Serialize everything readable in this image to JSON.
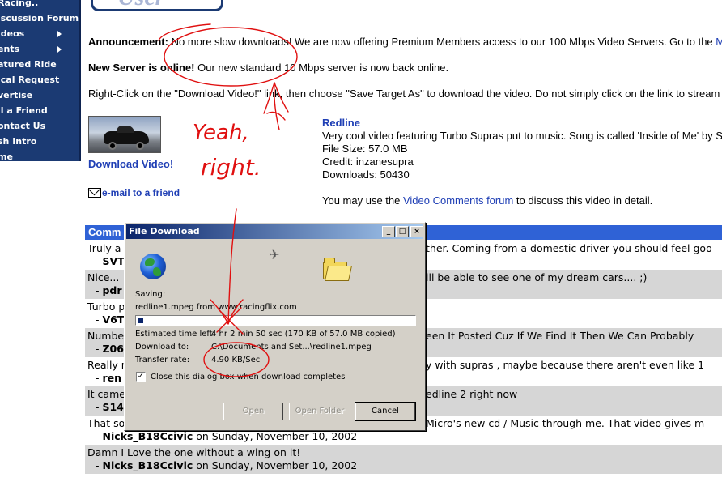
{
  "nav": {
    "items": [
      {
        "label": "Racing.."
      },
      {
        "label": "iscussion Forums"
      },
      {
        "label": "ideos",
        "arrow": true
      },
      {
        "label": "ents",
        "arrow": true
      },
      {
        "label": "atured Ride"
      },
      {
        "label": "ical Request"
      },
      {
        "label": "vertise"
      },
      {
        "label": "ll a Friend"
      },
      {
        "label": "ontact Us"
      },
      {
        "label": "sh Intro"
      },
      {
        "label": "me"
      }
    ]
  },
  "header": {
    "logo_text": "User Video"
  },
  "announcement": {
    "label": "Announcement:",
    "text": "No more slow downloads! We are now offering Premium Members access to our 100 Mbps Video Servers. Go to the",
    "link_frag": "M"
  },
  "server": {
    "label": "New Server is online!",
    "text": "Our new standard 10 Mbps server is now back online."
  },
  "instruction": "Right-Click on the \"Download Video!\" link, then choose \"Save Target As\" to download the video. Do not simply click on the link to stream",
  "video": {
    "download_label": "Download Video!",
    "email_label": "e-mail to a friend",
    "title": "Redline",
    "description": "Very cool video featuring Turbo Supras put to music. Song is called 'Inside of Me' by S",
    "file_size": "File Size: 57.0 MB",
    "credit": "Credit: inzanesupra",
    "downloads": "Downloads: 50430",
    "discuss_pre": "You may use the ",
    "discuss_link": "Video Comments forum",
    "discuss_post": " to discuss this video in detail."
  },
  "comments": {
    "header": "Comm",
    "rows": [
      {
        "text_left": "Truly a",
        "text_right": "ther. Coming from a domestic driver you should feel goo",
        "by_user": "SVT",
        "by_rest": ""
      },
      {
        "text_left": "Nice...",
        "text_right": "ill be able to see one of my dream cars.... ;)",
        "by_user": "pdr",
        "by_rest": ""
      },
      {
        "text_left": "Turbo p",
        "text_right": "",
        "by_user": "V6T",
        "by_rest": ""
      },
      {
        "text_left": "Numbe",
        "text_right": "een It Posted Cuz If We Find It Then We Can Probably",
        "by_user": "Z06",
        "by_rest": ""
      },
      {
        "text_left": "Really r",
        "text_right": "y with supras , maybe because there aren't even like 1",
        "by_user": "ren",
        "by_rest": ""
      },
      {
        "text_left": "It came",
        "text_right": "edline 2 right now",
        "by_user": "S14",
        "by_rest": ""
      },
      {
        "text_left": "That so",
        "text_right": "Micro's new cd / Music through me. That video gives m",
        "by_user": "Nicks_B18Ccivic",
        "by_rest": " on Sunday, November 10, 2002"
      },
      {
        "text_left": "Damn I Love the one without a wing on it!",
        "text_right": "",
        "by_user": "Nicks_B18Ccivic",
        "by_rest": " on Sunday, November 10, 2002"
      }
    ]
  },
  "dialog": {
    "title": "File Download",
    "saving_label": "Saving:",
    "file_line": "redline1.mpeg from www.racingflix.com",
    "progress": 0.02,
    "time_left_label": "Estimated time left:",
    "time_left_value": "4 hr 2 min 50 sec (170 KB of 57.0 MB copied)",
    "download_to_label": "Download to:",
    "download_to_value": "C:\\Documents and Set...\\redline1.mpeg",
    "rate_label": "Transfer rate:",
    "rate_value": "4.90 KB/Sec",
    "close_checkbox_label": "Close this dialog box when download completes",
    "close_checked": true,
    "open_button": "Open",
    "open_folder_button": "Open Folder",
    "cancel_button": "Cancel"
  },
  "annotation": {
    "handwriting_1": "Yeah,",
    "handwriting_2": "right.",
    "color": "#e01010"
  }
}
